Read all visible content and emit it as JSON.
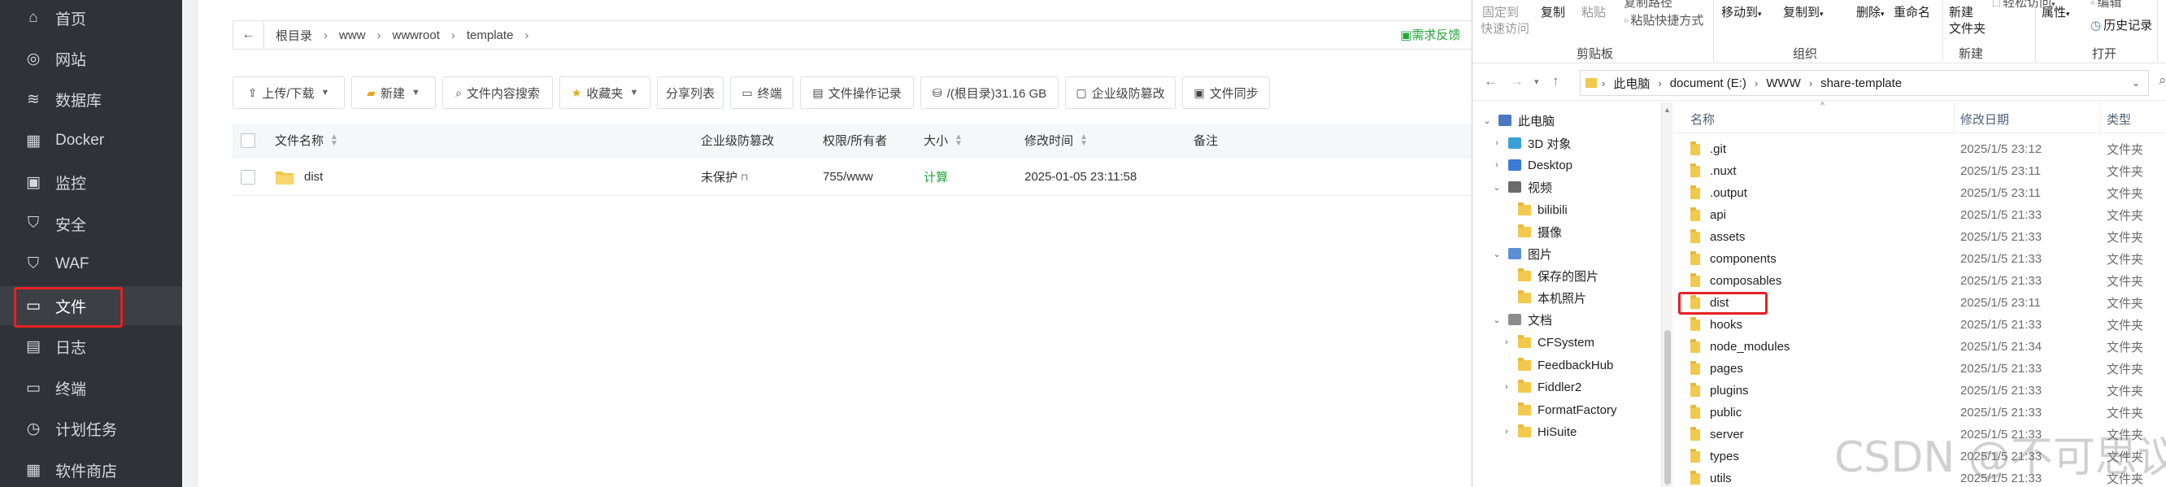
{
  "sidebar": {
    "items": [
      {
        "label": "首页",
        "icon": "home-icon"
      },
      {
        "label": "网站",
        "icon": "globe-icon"
      },
      {
        "label": "数据库",
        "icon": "database-icon"
      },
      {
        "label": "Docker",
        "icon": "docker-icon"
      },
      {
        "label": "监控",
        "icon": "monitor-icon"
      },
      {
        "label": "安全",
        "icon": "shield-icon"
      },
      {
        "label": "WAF",
        "icon": "waf-shield-icon"
      },
      {
        "label": "文件",
        "icon": "folder-icon"
      },
      {
        "label": "日志",
        "icon": "log-icon"
      },
      {
        "label": "终端",
        "icon": "terminal-icon"
      },
      {
        "label": "计划任务",
        "icon": "clock-icon"
      },
      {
        "label": "软件商店",
        "icon": "grid-icon"
      }
    ],
    "active": "文件"
  },
  "files": {
    "path": [
      "根目录",
      "www",
      "wwwroot",
      "template"
    ],
    "feedback": "需求反馈",
    "toolbar": {
      "upload": "上传/下载",
      "new": "新建",
      "search": "文件内容搜索",
      "favorites": "收藏夹",
      "share": "分享列表",
      "terminal": "终端",
      "oplog": "文件操作记录",
      "disk": "/(根目录)31.16 GB",
      "protect": "企业级防篡改",
      "sync": "文件同步"
    },
    "columns": {
      "name": "文件名称",
      "protect": "企业级防篡改",
      "perm": "权限/所有者",
      "size": "大小",
      "mtime": "修改时间",
      "note": "备注"
    },
    "rows": [
      {
        "name": "dist",
        "protect": "未保护",
        "perm": "755/www",
        "size": "计算",
        "mtime": "2025-01-05 23:11:58"
      }
    ]
  },
  "explorer": {
    "ribbon": {
      "pin": "固定到",
      "quick": "快速访问",
      "copy": "复制",
      "paste": "粘贴",
      "copy_path": "复制路径",
      "paste_shortcut": "粘贴快捷方式",
      "move_to": "移动到",
      "copy_to": "复制到",
      "delete": "删除",
      "rename": "重命名",
      "new_folder_1": "新建",
      "new_folder_2": "文件夹",
      "easy_access": "轻松访问",
      "properties": "属性",
      "edit": "编辑",
      "history": "历史记录",
      "group_clipboard": "剪贴板",
      "group_organize": "组织",
      "group_new": "新建",
      "group_open": "打开"
    },
    "address": [
      "此电脑",
      "document (E:)",
      "WWW",
      "share-template"
    ],
    "tree": [
      {
        "label": "此电脑",
        "level": 0,
        "caret": "v",
        "kind": "pc"
      },
      {
        "label": "3D 对象",
        "level": 1,
        "caret": ">",
        "kind": "3d"
      },
      {
        "label": "Desktop",
        "level": 1,
        "caret": ">",
        "kind": "desktop"
      },
      {
        "label": "视频",
        "level": 1,
        "caret": "v",
        "kind": "video"
      },
      {
        "label": "bilibili",
        "level": 2,
        "caret": "",
        "kind": "folder"
      },
      {
        "label": "摄像",
        "level": 2,
        "caret": "",
        "kind": "folder"
      },
      {
        "label": "图片",
        "level": 1,
        "caret": "v",
        "kind": "pictures"
      },
      {
        "label": "保存的图片",
        "level": 2,
        "caret": "",
        "kind": "folder"
      },
      {
        "label": "本机照片",
        "level": 2,
        "caret": "",
        "kind": "folder"
      },
      {
        "label": "文档",
        "level": 1,
        "caret": "v",
        "kind": "docs"
      },
      {
        "label": "CFSystem",
        "level": 2,
        "caret": ">",
        "kind": "folder"
      },
      {
        "label": "FeedbackHub",
        "level": 2,
        "caret": "",
        "kind": "folder"
      },
      {
        "label": "Fiddler2",
        "level": 2,
        "caret": ">",
        "kind": "folder"
      },
      {
        "label": "FormatFactory",
        "level": 2,
        "caret": "",
        "kind": "folder"
      },
      {
        "label": "HiSuite",
        "level": 2,
        "caret": ">",
        "kind": "folder"
      }
    ],
    "columns": {
      "name": "名称",
      "date": "修改日期",
      "type": "类型"
    },
    "files": [
      {
        "name": ".git",
        "date": "2025/1/5 23:12",
        "type": "文件夹"
      },
      {
        "name": ".nuxt",
        "date": "2025/1/5 23:11",
        "type": "文件夹"
      },
      {
        "name": ".output",
        "date": "2025/1/5 23:11",
        "type": "文件夹"
      },
      {
        "name": "api",
        "date": "2025/1/5 21:33",
        "type": "文件夹"
      },
      {
        "name": "assets",
        "date": "2025/1/5 21:33",
        "type": "文件夹"
      },
      {
        "name": "components",
        "date": "2025/1/5 21:33",
        "type": "文件夹"
      },
      {
        "name": "composables",
        "date": "2025/1/5 21:33",
        "type": "文件夹"
      },
      {
        "name": "dist",
        "date": "2025/1/5 23:11",
        "type": "文件夹"
      },
      {
        "name": "hooks",
        "date": "2025/1/5 21:33",
        "type": "文件夹"
      },
      {
        "name": "node_modules",
        "date": "2025/1/5 21:34",
        "type": "文件夹"
      },
      {
        "name": "pages",
        "date": "2025/1/5 21:33",
        "type": "文件夹"
      },
      {
        "name": "plugins",
        "date": "2025/1/5 21:33",
        "type": "文件夹"
      },
      {
        "name": "public",
        "date": "2025/1/5 21:33",
        "type": "文件夹"
      },
      {
        "name": "server",
        "date": "2025/1/5 21:33",
        "type": "文件夹"
      },
      {
        "name": "types",
        "date": "2025/1/5 21:33",
        "type": "文件夹"
      },
      {
        "name": "utils",
        "date": "2025/1/5 21:33",
        "type": "文件夹"
      }
    ]
  },
  "watermark": "CSDN @不可思议的",
  "colors": {
    "sidebar": "#2f3237",
    "accent_green": "#20a53a",
    "highlight_red": "#e52222",
    "folder_yellow": "#f2c94c"
  }
}
